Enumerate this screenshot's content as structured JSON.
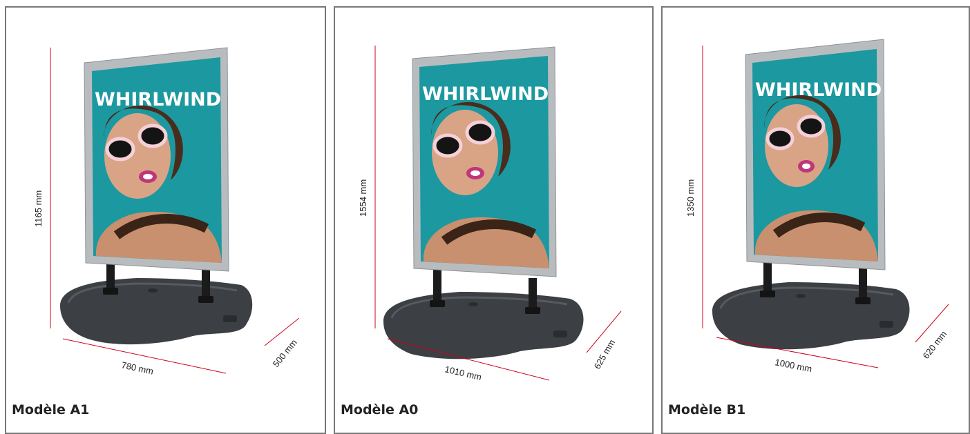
{
  "panels": [
    {
      "model_label": "Modèle A1",
      "brand": "WHIRLWIND",
      "height_label": "1165 mm",
      "width_label": "780 mm",
      "depth_label": "500 mm"
    },
    {
      "model_label": "Modèle A0",
      "brand": "WHIRLWIND",
      "height_label": "1554 mm",
      "width_label": "1010 mm",
      "depth_label": "625 mm"
    },
    {
      "model_label": "Modèle B1",
      "brand": "WHIRLWIND",
      "height_label": "1350 mm",
      "width_label": "1000 mm",
      "depth_label": "620 mm"
    }
  ],
  "colors": {
    "panel_border": "#777777",
    "dimension_line": "#d0001c",
    "poster_background": "#1c98a0",
    "frame": "#b9bcbf",
    "base": "#3c3f43",
    "spring": "#1b1b1b"
  }
}
